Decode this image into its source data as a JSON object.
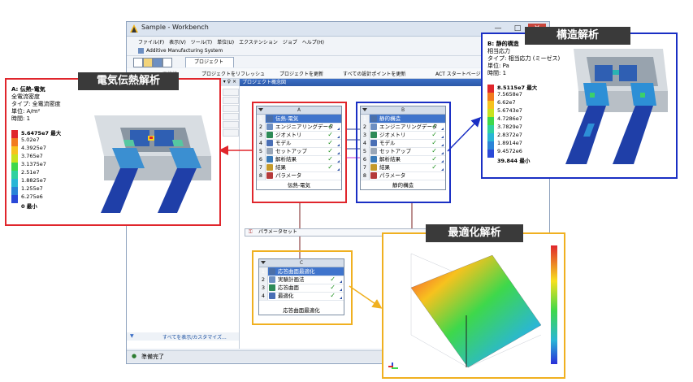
{
  "window": {
    "title": "Sample - Workbench",
    "min_btn": "—",
    "max_btn": "□",
    "close_btn": "✕"
  },
  "menu": {
    "items": [
      "ファイル(F)",
      "表示(V)",
      "ツール(T)",
      "単位(U)",
      "エクステンション",
      "ジョブ",
      "ヘルプ(H)"
    ]
  },
  "ams_label": "Additive Manufacturing System",
  "project_tab": "プロジェクト",
  "toolbar2": {
    "reconnect": "再接続",
    "refresh": "プロジェクトをリフレッシュ",
    "update": "プロジェクトを更新",
    "update_all": "すべての設計ポイントを更新",
    "act": "ACT スタートページ"
  },
  "toolbox": {
    "head_btns": "▾ ♀ ×",
    "footer": "すべてを表示/カスタマイズ..."
  },
  "schematic": {
    "header": "プロジェクト概念図"
  },
  "systems": {
    "A": {
      "col": "A",
      "name": "伝熱-電気",
      "rows": [
        {
          "n": "1",
          "label": "伝熱-電気",
          "sel": true
        },
        {
          "n": "2",
          "label": "エンジニアリングデータ",
          "check": "✓"
        },
        {
          "n": "3",
          "label": "ジオメトリ",
          "check": "✓"
        },
        {
          "n": "4",
          "label": "モデル",
          "check": "✓"
        },
        {
          "n": "5",
          "label": "セットアップ",
          "check": "✓"
        },
        {
          "n": "6",
          "label": "解析結果",
          "check": "✓"
        },
        {
          "n": "7",
          "label": "結果",
          "check": "✓"
        },
        {
          "n": "8",
          "label": "パラメータ"
        }
      ]
    },
    "B": {
      "col": "B",
      "name": "静的構造",
      "rows": [
        {
          "n": "1",
          "label": "静的構造",
          "sel": true
        },
        {
          "n": "2",
          "label": "エンジニアリングデータ",
          "check": "✓"
        },
        {
          "n": "3",
          "label": "ジオメトリ",
          "check": "✓"
        },
        {
          "n": "4",
          "label": "モデル",
          "check": "✓"
        },
        {
          "n": "5",
          "label": "セットアップ",
          "check": "✓"
        },
        {
          "n": "6",
          "label": "解析結果",
          "check": "✓"
        },
        {
          "n": "7",
          "label": "結果",
          "check": "✓"
        },
        {
          "n": "8",
          "label": "パラメータ"
        }
      ]
    },
    "C": {
      "col": "C",
      "name": "応答曲面最適化",
      "rows": [
        {
          "n": "1",
          "label": "応答曲面最適化",
          "sel": true
        },
        {
          "n": "2",
          "label": "実験計画法",
          "check": "✓"
        },
        {
          "n": "3",
          "label": "応答曲面",
          "check": "✓"
        },
        {
          "n": "4",
          "label": "最適化",
          "check": "✓"
        }
      ]
    }
  },
  "param_set": "パラメータセット",
  "status": {
    "text": "準備完了"
  },
  "panels": {
    "electric": {
      "tag": "電気伝熱解析",
      "title": "A: 伝熱-電気",
      "l2": "全電流密度",
      "l3": "タイプ: 全電流密度",
      "l4": "単位: A/m²",
      "l5": "時間: 1",
      "legend": [
        "5.6475e7 最大",
        "5.02e7",
        "4.3925e7",
        "3.765e7",
        "3.1375e7",
        "2.51e7",
        "1.8825e7",
        "1.255e7",
        "6.275e6",
        "0 最小"
      ]
    },
    "structural": {
      "tag": "構造解析",
      "title": "B: 静的構造",
      "l2": "相当応力",
      "l3": "タイプ: 相当応力 (ミーゼス)",
      "l4": "単位: Pa",
      "l5": "時間: 1",
      "legend": [
        "8.5115e7 最大",
        "7.5658e7",
        "6.62e7",
        "5.6743e7",
        "4.7286e7",
        "3.7829e7",
        "2.8372e7",
        "1.8914e7",
        "9.4572e6",
        "39.844 最小"
      ]
    },
    "optimization": {
      "tag": "最適化解析"
    }
  },
  "colors": {
    "red_frame": "#e0262c",
    "blue_frame": "#1a2fc4",
    "orange_frame": "#f0b020",
    "accent": "#3f74cc"
  }
}
